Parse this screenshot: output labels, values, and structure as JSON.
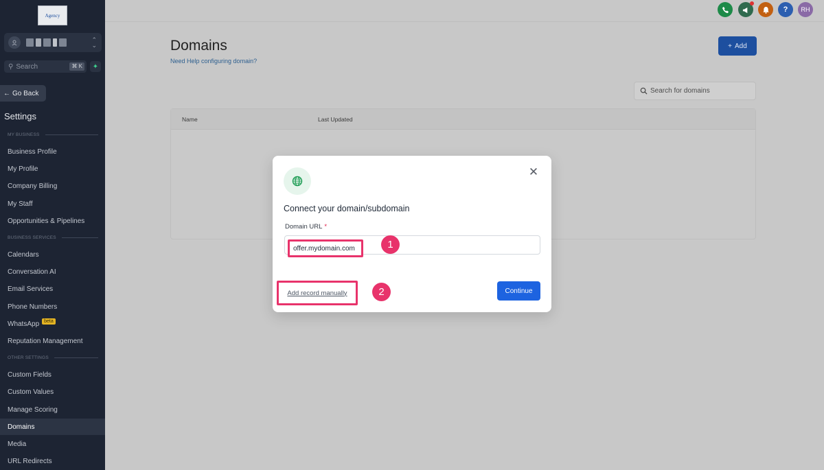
{
  "sidebar": {
    "logo_text": "Agency",
    "search_placeholder": "Search",
    "search_shortcut": "⌘ K",
    "go_back": "Go Back",
    "settings_title": "Settings",
    "sections": {
      "my_business": "MY BUSINESS",
      "business_services": "BUSINESS SERVICES",
      "other_settings": "OTHER SETTINGS"
    },
    "items": {
      "business_profile": "Business Profile",
      "my_profile": "My Profile",
      "company_billing": "Company Billing",
      "my_staff": "My Staff",
      "opportunities": "Opportunities & Pipelines",
      "calendars": "Calendars",
      "conversation_ai": "Conversation AI",
      "email_services": "Email Services",
      "phone_numbers": "Phone Numbers",
      "whatsapp": "WhatsApp",
      "whatsapp_badge": "beta",
      "reputation": "Reputation Management",
      "custom_fields": "Custom Fields",
      "custom_values": "Custom Values",
      "manage_scoring": "Manage Scoring",
      "domains": "Domains",
      "media": "Media",
      "url_redirects": "URL Redirects"
    },
    "active_item": "Domains"
  },
  "topbar": {
    "avatar_initials": "RH",
    "help_icon_glyph": "?",
    "colors": {
      "phone": "#1d8a48",
      "megaphone": "#2f6a4e",
      "bell": "#c26011",
      "help": "#2c5fb0",
      "avatar": "#8a6aa6"
    }
  },
  "page": {
    "title": "Domains",
    "help_link": "Need Help configuring domain?",
    "add_button": "Add",
    "search_placeholder": "Search for domains",
    "table_headers": {
      "name": "Name",
      "last_updated": "Last Updated"
    }
  },
  "modal": {
    "title": "Connect your domain/subdomain",
    "field_label": "Domain URL",
    "required_marker": "*",
    "input_value": "offer.mydomain.com",
    "add_record_link": "Add record manually",
    "continue_button": "Continue",
    "close_glyph": "✕",
    "annotation_1": "1",
    "annotation_2": "2"
  },
  "colors": {
    "sidebar_bg": "#1d2433",
    "primary": "#1d63e0",
    "highlight": "#e8336b",
    "globe_green": "#1f9d55"
  }
}
